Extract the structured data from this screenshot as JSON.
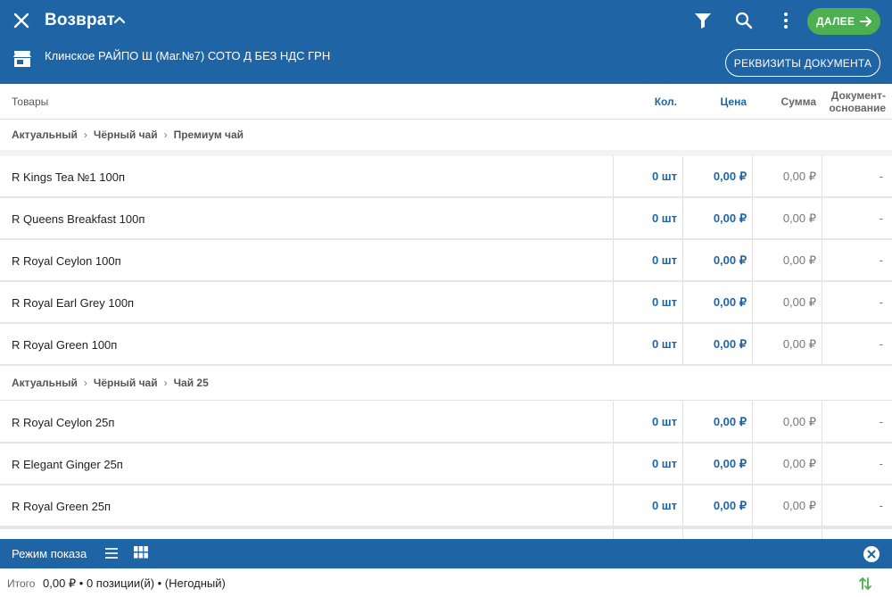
{
  "app": {
    "title": "Возврат",
    "shop": "Клинское РАЙПО Ш (Маг.№7) СОТО Д БЕЗ НДС  ГРН",
    "next_label": "ДАЛЕЕ",
    "doc_details_label": "РЕКВИЗИТЫ ДОКУМЕНТА",
    "accent_color": "#1f65a6",
    "next_color": "#4caf50"
  },
  "columns": {
    "goods": "Товары",
    "qty": "Кол.",
    "price": "Цена",
    "sum": "Сумма",
    "doc": "Документ-\nоснование"
  },
  "groups": [
    {
      "crumbs": [
        "Актуальный",
        "Чёрный чай",
        "Премиум чай"
      ],
      "rows": [
        {
          "name": "R Kings Tea №1 100п",
          "qty": "0 шт",
          "price": "0,00 ₽",
          "sum": "0,00 ₽",
          "doc": "-"
        },
        {
          "name": "R Queens Breakfast 100п",
          "qty": "0 шт",
          "price": "0,00 ₽",
          "sum": "0,00 ₽",
          "doc": "-"
        },
        {
          "name": "R Royal Ceylon 100п",
          "qty": "0 шт",
          "price": "0,00 ₽",
          "sum": "0,00 ₽",
          "doc": "-"
        },
        {
          "name": "R Royal Earl Grey 100п",
          "qty": "0 шт",
          "price": "0,00 ₽",
          "sum": "0,00 ₽",
          "doc": "-"
        },
        {
          "name": "R Royal Green 100п",
          "qty": "0 шт",
          "price": "0,00 ₽",
          "sum": "0,00 ₽",
          "doc": "-"
        }
      ]
    },
    {
      "crumbs": [
        "Актуальный",
        "Чёрный чай",
        "Чай 25"
      ],
      "rows": [
        {
          "name": "R Royal Ceylon 25п",
          "qty": "0 шт",
          "price": "0,00 ₽",
          "sum": "0,00 ₽",
          "doc": "-"
        },
        {
          "name": "R Elegant Ginger 25п",
          "qty": "0 шт",
          "price": "0,00 ₽",
          "sum": "0,00 ₽",
          "doc": "-"
        },
        {
          "name": "R Royal Green 25п",
          "qty": "0 шт",
          "price": "0,00 ₽",
          "sum": "0,00 ₽",
          "doc": "-"
        }
      ]
    }
  ],
  "crumb_separator": "›",
  "bottom": {
    "mode_label": "Режим показа"
  },
  "footer": {
    "label": "Итого",
    "summary": "0,00 ₽  •  0 позиции(й)  •  (Негодный)"
  }
}
